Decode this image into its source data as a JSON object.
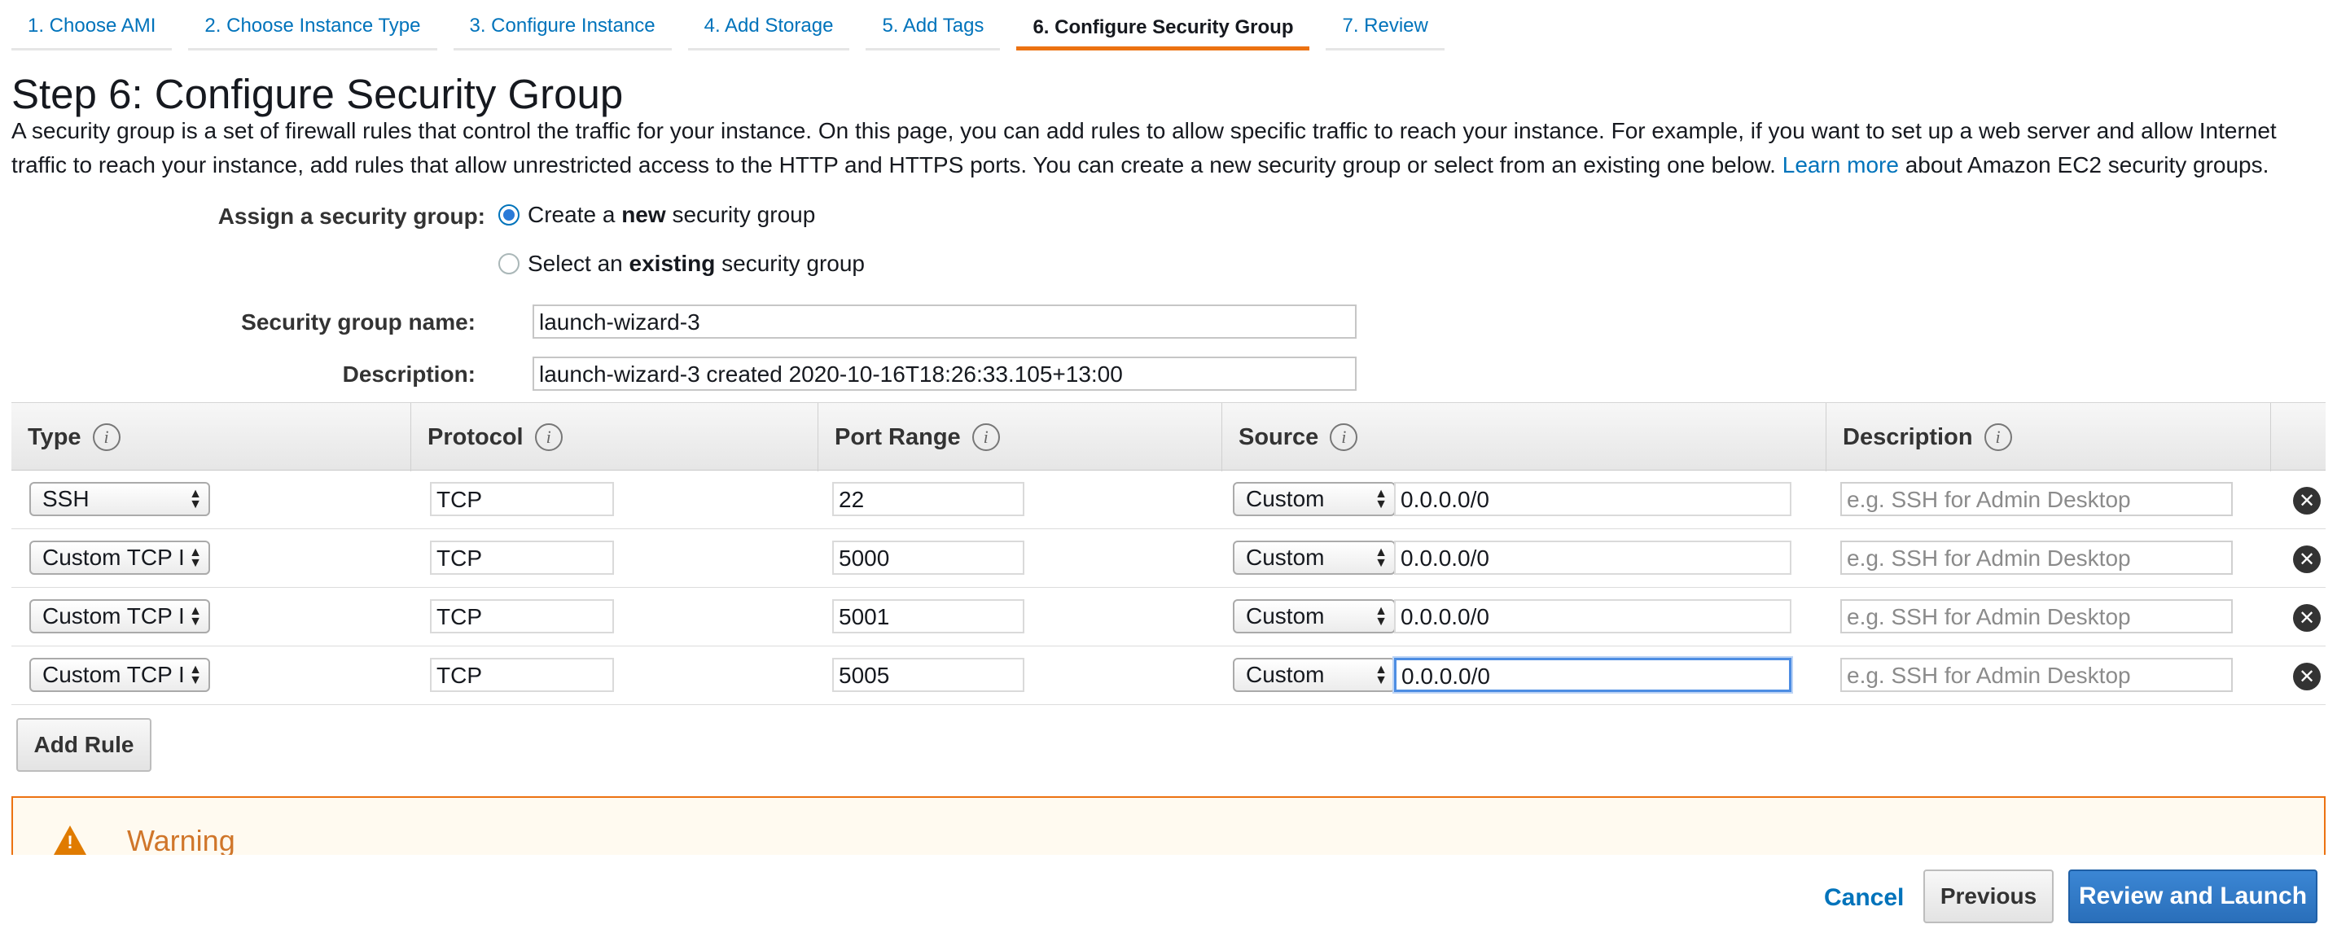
{
  "steps": [
    {
      "label": "1. Choose AMI"
    },
    {
      "label": "2. Choose Instance Type"
    },
    {
      "label": "3. Configure Instance"
    },
    {
      "label": "4. Add Storage"
    },
    {
      "label": "5. Add Tags"
    },
    {
      "label": "6. Configure Security Group"
    },
    {
      "label": "7. Review"
    }
  ],
  "active_step": "6. Configure Security Group",
  "page_title": "Step 6: Configure Security Group",
  "intro": {
    "text": "A security group is a set of firewall rules that control the traffic for your instance. On this page, you can add rules to allow specific traffic to reach your instance. For example, if you want to set up a web server and allow Internet traffic to reach your instance, add rules that allow unrestricted access to the HTTP and HTTPS ports. You can create a new security group or select from an existing one below.",
    "link": "Learn more",
    "suffix": "about Amazon EC2 security groups."
  },
  "assign": {
    "label": "Assign a security group:",
    "option_new_pre": "Create a",
    "option_new_bold": "new",
    "option_new_post": "security group",
    "option_existing_pre": "Select an",
    "option_existing_bold": "existing",
    "option_existing_post": "security group",
    "selected": "new"
  },
  "form": {
    "name_label": "Security group name:",
    "name_value": "launch-wizard-3",
    "desc_label": "Description:",
    "desc_value": "launch-wizard-3 created 2020-10-16T18:26:33.105+13:00"
  },
  "table": {
    "headers": {
      "type": "Type",
      "protocol": "Protocol",
      "port_range": "Port Range",
      "source": "Source",
      "description": "Description"
    },
    "info_glyph": "i",
    "rows": [
      {
        "type": "SSH",
        "protocol": "TCP",
        "port": "22",
        "source_type": "Custom",
        "source": "0.0.0.0/0",
        "desc_placeholder": "e.g. SSH for Admin Desktop"
      },
      {
        "type": "Custom TCP I",
        "protocol": "TCP",
        "port": "5000",
        "source_type": "Custom",
        "source": "0.0.0.0/0",
        "desc_placeholder": "e.g. SSH for Admin Desktop"
      },
      {
        "type": "Custom TCP I",
        "protocol": "TCP",
        "port": "5001",
        "source_type": "Custom",
        "source": "0.0.0.0/0",
        "desc_placeholder": "e.g. SSH for Admin Desktop"
      },
      {
        "type": "Custom TCP I",
        "protocol": "TCP",
        "port": "5005",
        "source_type": "Custom",
        "source": "0.0.0.0/0",
        "desc_placeholder": "e.g. SSH for Admin Desktop"
      }
    ],
    "remove_glyph": "✕"
  },
  "add_rule": "Add Rule",
  "warning": {
    "title": "Warning",
    "glyph": "!"
  },
  "footer": {
    "cancel": "Cancel",
    "previous": "Previous",
    "review_launch": "Review and Launch"
  },
  "colors": {
    "link": "#0073bb",
    "active_tab_underline": "#ec7211",
    "warning_border": "#ec7211",
    "primary_button": "#2a6fba"
  }
}
